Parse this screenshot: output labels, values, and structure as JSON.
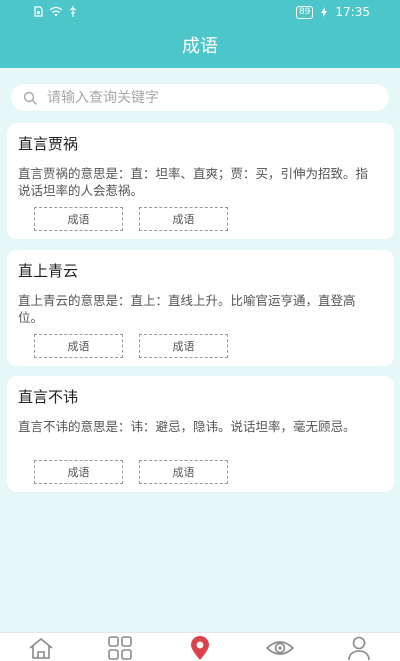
{
  "status_bar": {
    "battery": "89",
    "time": "17:35"
  },
  "header": {
    "title": "成语"
  },
  "search": {
    "placeholder": "请输入查询关键字"
  },
  "cards": [
    {
      "title": "直言贾祸",
      "desc": "直言贾祸的意思是：直：坦率、直爽；贾：买，引伸为招致。指说话坦率的人会惹祸。",
      "tags": [
        "成语",
        "成语"
      ]
    },
    {
      "title": "直上青云",
      "desc": "直上青云的意思是：直上：直线上升。比喻官运亨通，直登高位。",
      "tags": [
        "成语",
        "成语"
      ]
    },
    {
      "title": "直言不讳",
      "desc": "直言不讳的意思是：讳：避忌，隐讳。说话坦率，毫无顾忌。",
      "tags": [
        "成语",
        "成语"
      ]
    }
  ],
  "colors": {
    "accent": "#4cc6c8",
    "background": "#e6f7f7",
    "active_nav": "#d9434c",
    "nav_icon": "#8a8a8a"
  },
  "bottom_nav": [
    {
      "icon": "home-icon",
      "active": false
    },
    {
      "icon": "grid-icon",
      "active": false
    },
    {
      "icon": "location-pin-icon",
      "active": true
    },
    {
      "icon": "eye-icon",
      "active": false
    },
    {
      "icon": "user-icon",
      "active": false
    }
  ]
}
